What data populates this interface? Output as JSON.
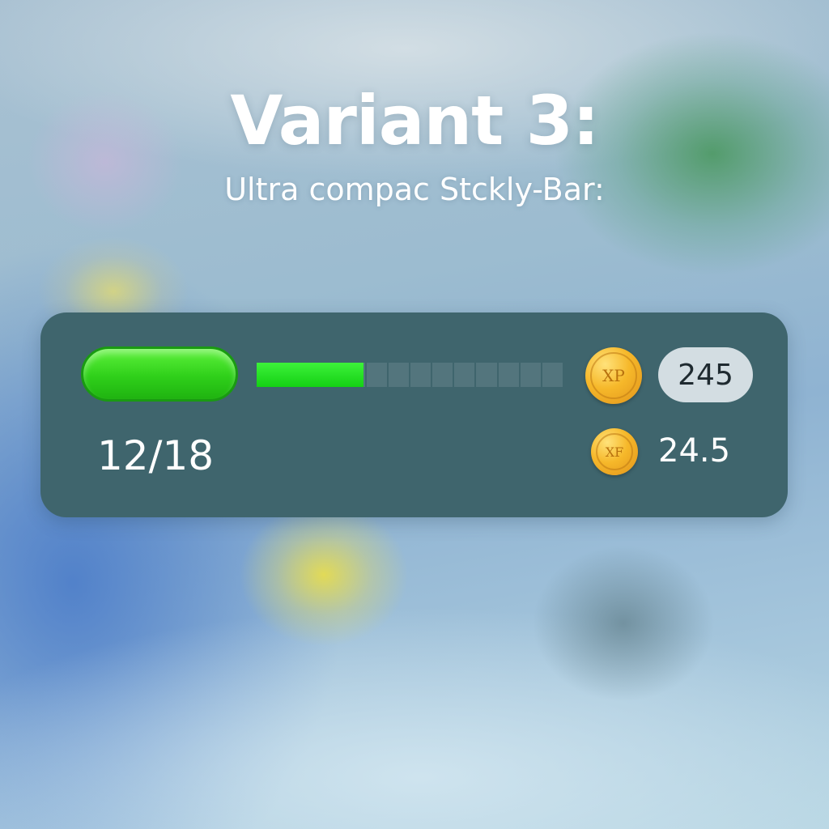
{
  "header": {
    "title": "Variant 3:",
    "subtitle": "Ultra compac Stckly-Bar:"
  },
  "sticky_bar": {
    "progress": {
      "fraction": 0.35,
      "segments": 14,
      "filled_color": "#22d41a"
    },
    "count_text": "12/18",
    "coin_top": {
      "label": "XP",
      "icon": "xp-coin-icon"
    },
    "coin_bottom": {
      "label": "XF",
      "icon": "xp-coin-icon"
    },
    "xp_badge_value": "245",
    "xp_value": "24.5"
  },
  "colors": {
    "bar_background": "#3f656d",
    "accent_green": "#2fd01a",
    "coin_gold": "#f6b82a",
    "badge_background": "#d3dde2"
  }
}
